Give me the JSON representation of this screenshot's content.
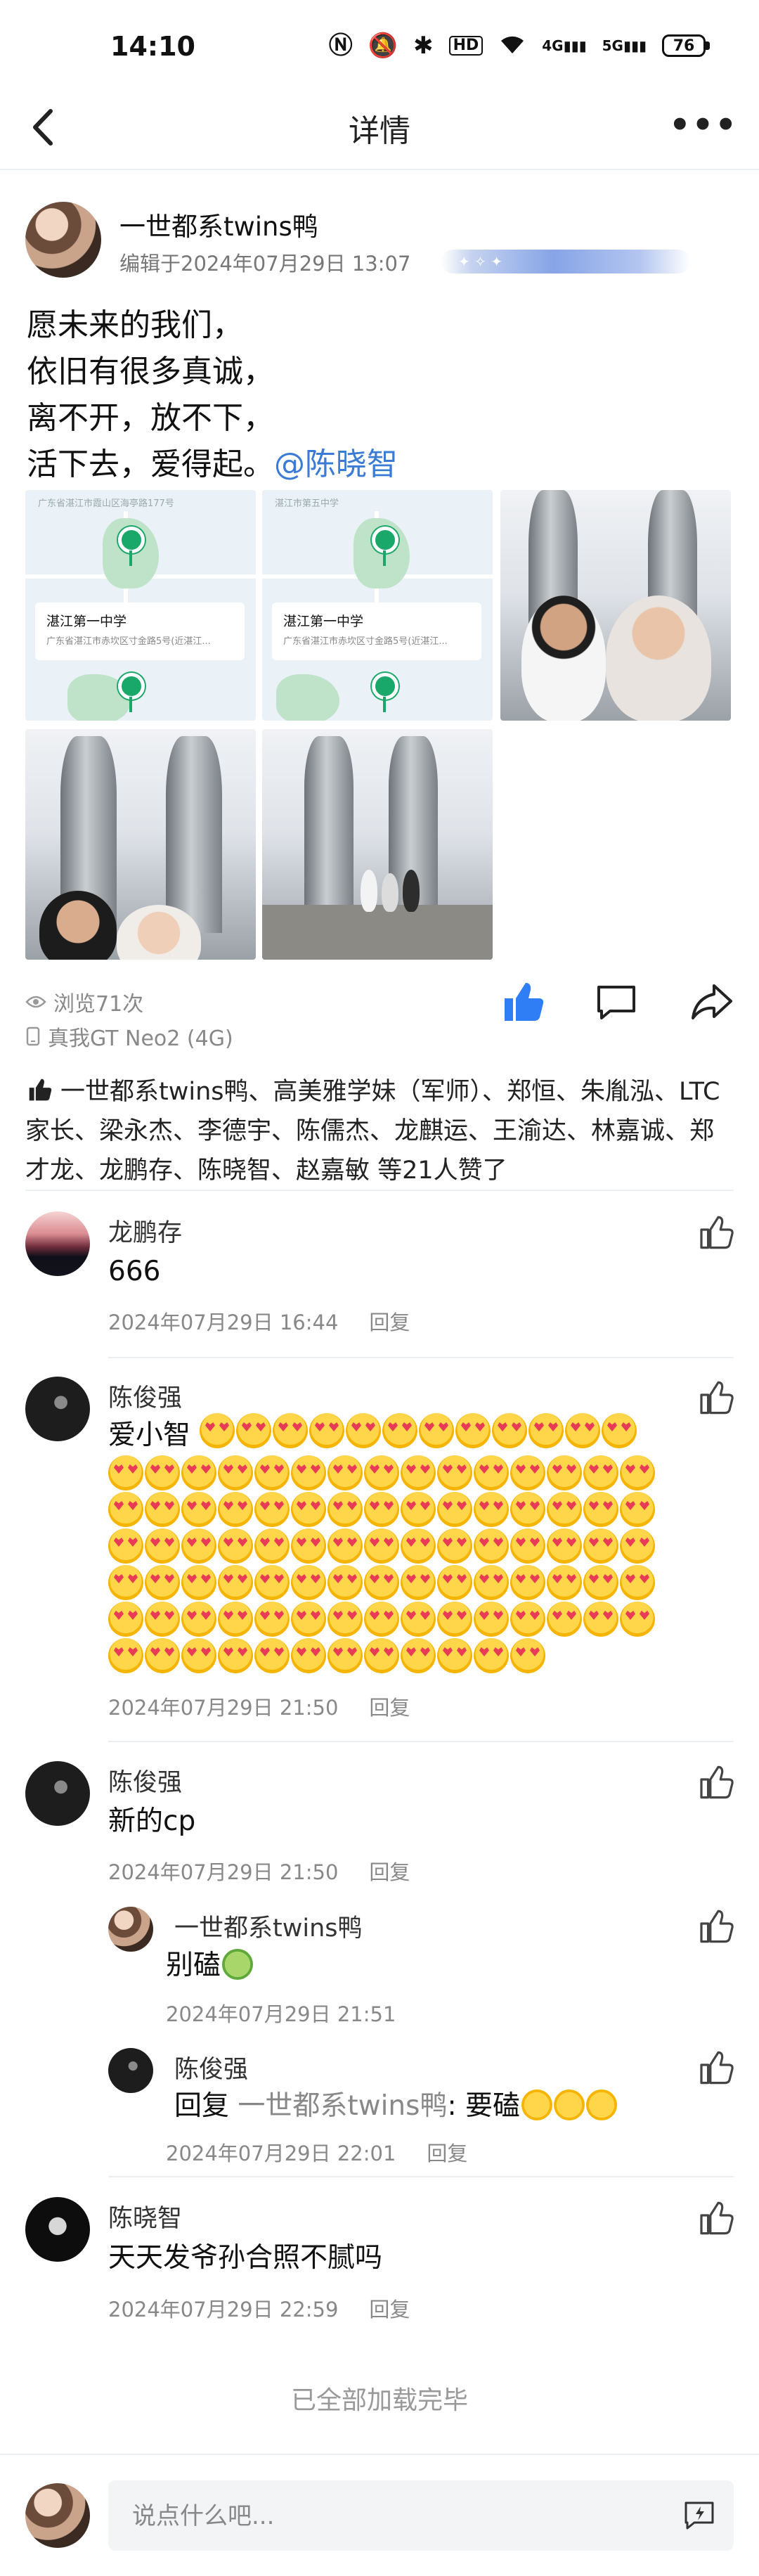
{
  "status_bar": {
    "time": "14:10",
    "battery": "76",
    "hd": "HD",
    "net4": "4G",
    "net5": "5G"
  },
  "nav": {
    "title": "详情"
  },
  "post": {
    "author": "一世都系twins鸭",
    "edit_time": "编辑于2024年07月29日 13:07",
    "lines": [
      "愿未来的我们，",
      "依旧有很多真诚，",
      "离不开，放不下，",
      "活下去，爱得起。"
    ],
    "mention": "@陈晓智",
    "map_tiles": [
      {
        "top_label": "广东省湛江市霞山区海亭路177号",
        "title": "湛江第一中学",
        "sub": "广东省湛江市赤坎区寸金路5号(近湛江..."
      },
      {
        "top_label": "湛江市第五中学",
        "title": "湛江第一中学",
        "sub": "广东省湛江市赤坎区寸金路5号(近湛江..."
      }
    ],
    "views": "浏览71次",
    "device": "真我GT Neo2 (4G)"
  },
  "likes": {
    "text": "一世都系twins鸭、高美雅学妹（军师）、郑恒、朱胤泓、LTC家长、梁永杰、李德宇、陈儒杰、龙麒运、王渝达、林嘉诚、郑才龙、龙鹏存、陈晓智、赵嘉敏 等21人赞了"
  },
  "comments": [
    {
      "name": "龙鹏存",
      "text": "666",
      "time": "2024年07月29日 16:44",
      "reply_label": "回复"
    },
    {
      "name": "陈俊强",
      "text": "爱小智",
      "time": "2024年07月29日 21:50",
      "reply_label": "回复"
    },
    {
      "name": "陈俊强",
      "text": "新的cp",
      "time": "2024年07月29日 21:50",
      "reply_label": "回复",
      "replies": [
        {
          "name": "一世都系twins鸭",
          "text": "别磕",
          "time": "2024年07月29日 21:51"
        },
        {
          "name": "陈俊强",
          "text_prefix": "回复 ",
          "reply_to": "一世都系twins鸭",
          "text": ": 要磕",
          "time": "2024年07月29日 22:01",
          "reply_label": "回复"
        }
      ]
    },
    {
      "name": "陈晓智",
      "text": "天天发爷孙合照不腻吗",
      "time": "2024年07月29日 22:59",
      "reply_label": "回复"
    }
  ],
  "loaded_text": "已全部加载完毕",
  "bottom": {
    "placeholder": "说点什么吧..."
  },
  "colors": {
    "accent": "#3a7bd5",
    "meta": "#888888"
  },
  "icons": [
    "back-icon",
    "more-icon",
    "like-icon",
    "comment-icon",
    "share-icon",
    "eye-icon",
    "phone-icon",
    "thumb-up-icon",
    "emoji-icon"
  ]
}
